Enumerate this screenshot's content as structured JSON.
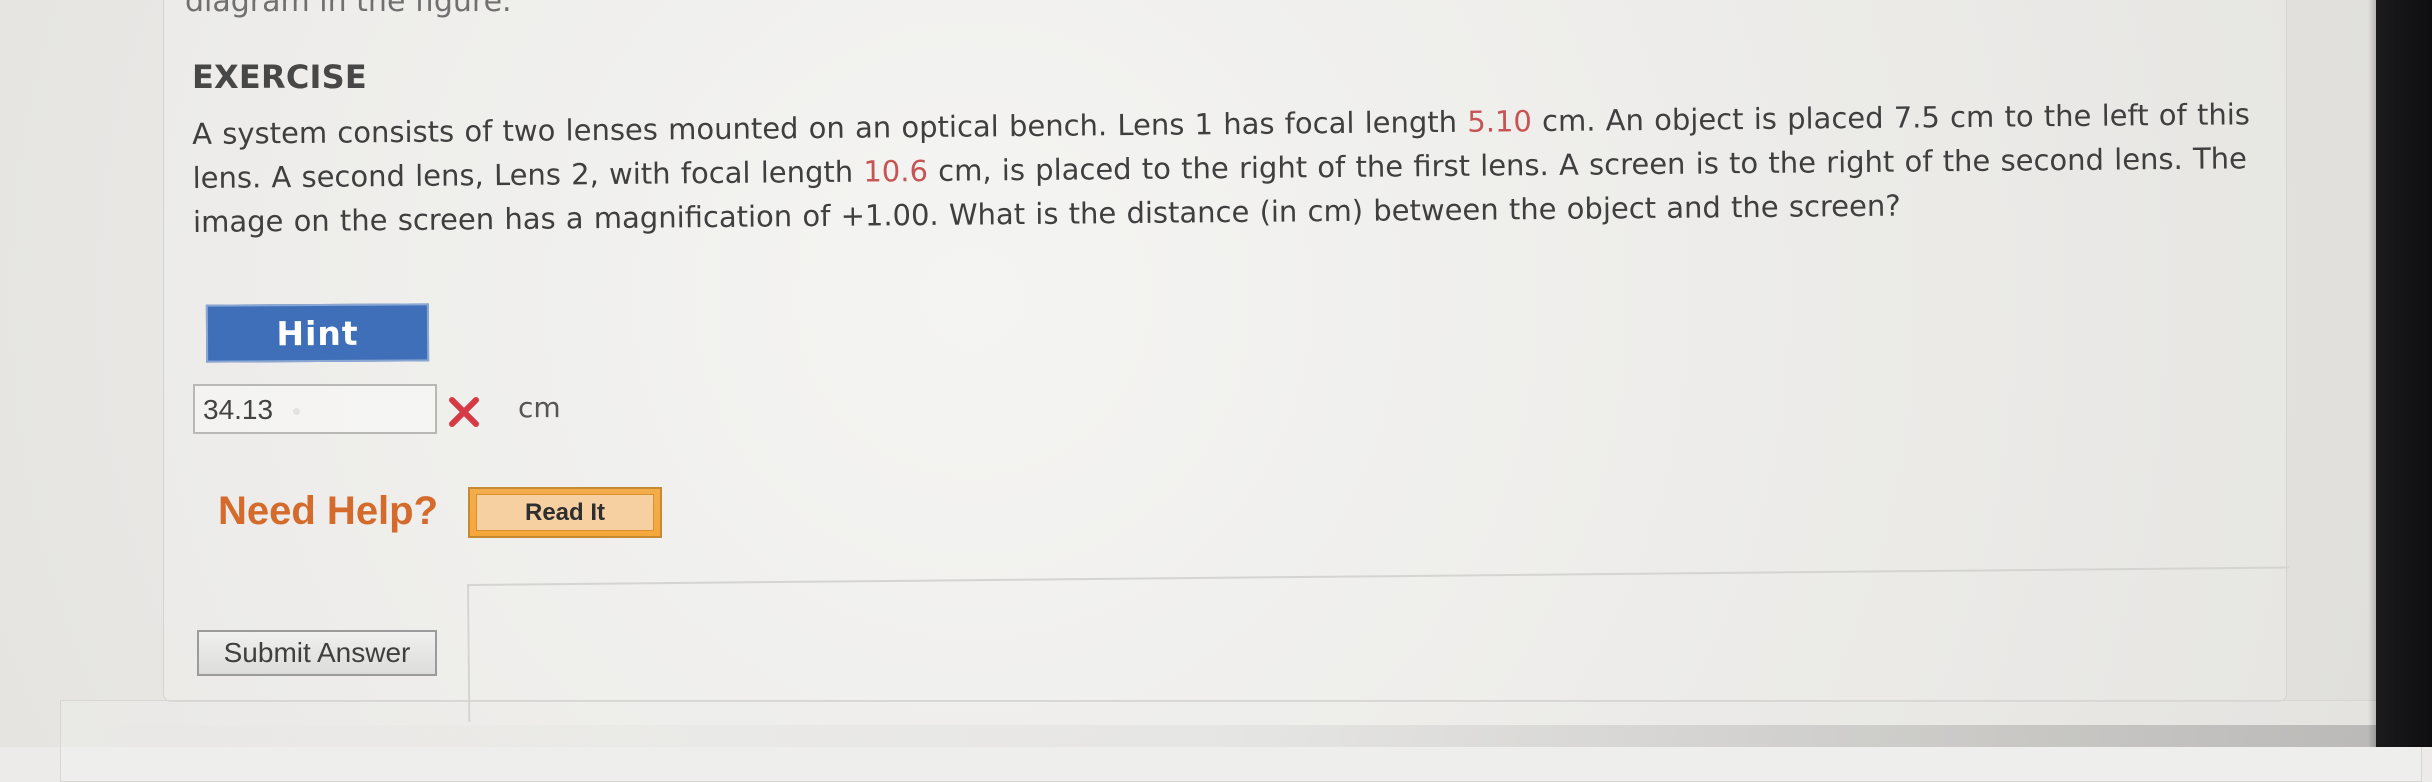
{
  "header": {
    "cut_off_text": "diagram in the figure."
  },
  "exercise": {
    "title": "EXERCISE",
    "question_parts": [
      "A system consists of two lenses mounted on an optical bench. Lens 1 has focal length ",
      "5.10",
      " cm. An object is placed 7.5 cm to the left of this lens. A second lens, Lens 2, with focal length ",
      "10.6",
      " cm, is placed to the right of the first lens. A screen is to the right of the second lens. The image on the screen has a magnification of +1.00. What is the distance (in cm) between the object and the screen?"
    ],
    "hint_label": "Hint",
    "answer": {
      "value": "34.13",
      "unit": "cm",
      "status_icon": "x-mark-icon"
    },
    "help": {
      "label": "Need Help?",
      "read_it_label": "Read It"
    },
    "submit_label": "Submit Answer"
  },
  "colors": {
    "highlight_red": "#c75454",
    "hint_blue": "#3f6fb8",
    "help_orange": "#d46a2c",
    "wrong_red": "#d63b45"
  }
}
